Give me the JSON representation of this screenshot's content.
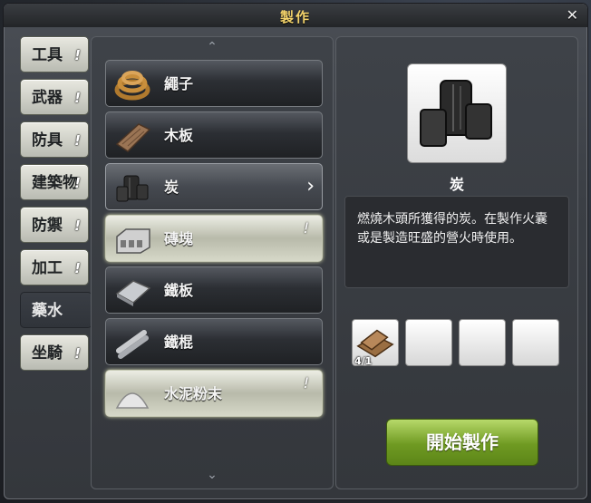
{
  "window": {
    "title": "製作",
    "close_label": "✕"
  },
  "categories": [
    {
      "label": "工具",
      "flag": "!"
    },
    {
      "label": "武器",
      "flag": "!"
    },
    {
      "label": "防具",
      "flag": "!"
    },
    {
      "label": "建築物",
      "flag": "!"
    },
    {
      "label": "防禦",
      "flag": "!"
    },
    {
      "label": "加工",
      "flag": "!"
    },
    {
      "label": "藥水",
      "flag": ""
    },
    {
      "label": "坐騎",
      "flag": "!"
    }
  ],
  "list": {
    "scroll_up": "⌃",
    "scroll_down": "⌄",
    "items": [
      {
        "label": "繩子",
        "icon": "rope-icon",
        "flag": ""
      },
      {
        "label": "木板",
        "icon": "wood-plank-icon",
        "flag": ""
      },
      {
        "label": "炭",
        "icon": "charcoal-icon",
        "flag": "",
        "chevron": "›"
      },
      {
        "label": "磚塊",
        "icon": "brick-icon",
        "flag": "!"
      },
      {
        "label": "鐵板",
        "icon": "iron-plate-icon",
        "flag": ""
      },
      {
        "label": "鐵棍",
        "icon": "iron-rod-icon",
        "flag": ""
      },
      {
        "label": "水泥粉末",
        "icon": "cement-powder-icon",
        "flag": "!"
      }
    ]
  },
  "detail": {
    "name": "炭",
    "description": "燃燒木頭所獲得的炭。在製作火囊或是製造旺盛的營火時使用。",
    "ingredients": [
      {
        "icon": "wood-log-icon",
        "count": "4/1"
      },
      {
        "icon": "",
        "count": ""
      },
      {
        "icon": "",
        "count": ""
      },
      {
        "icon": "",
        "count": ""
      }
    ],
    "start_button": "開始製作"
  }
}
